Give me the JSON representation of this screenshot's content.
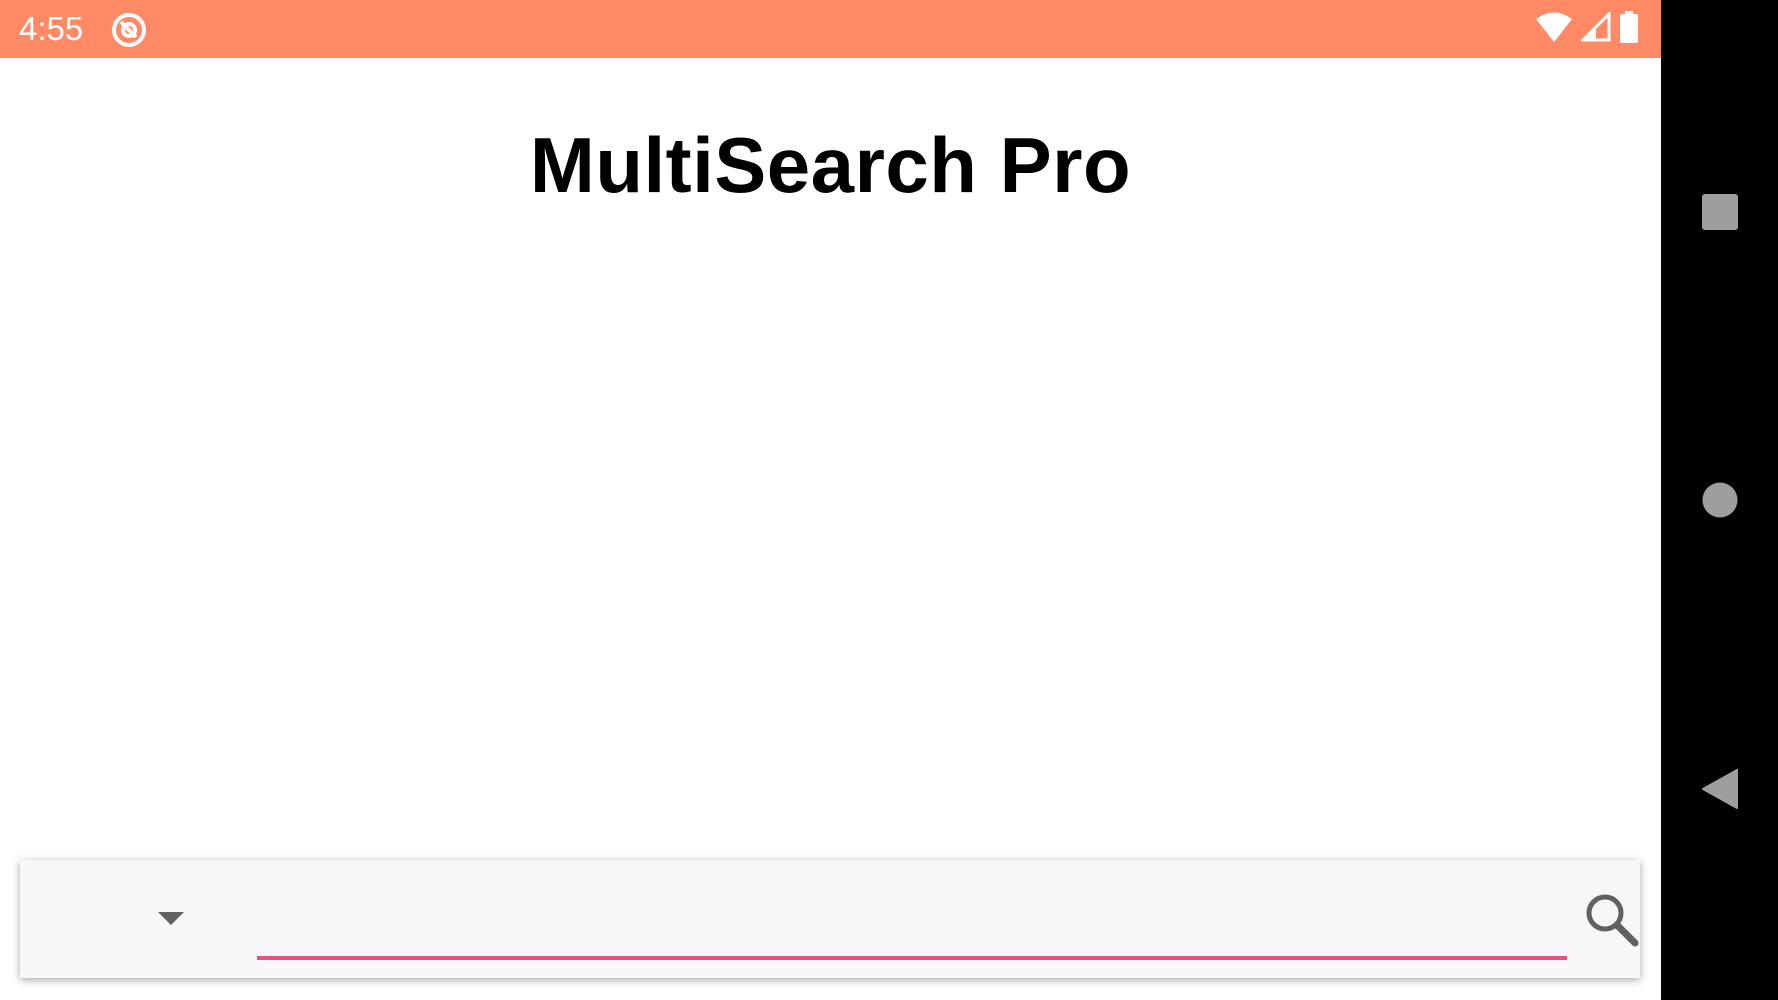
{
  "status_bar": {
    "time": "4:55",
    "background_color": "#ff8a65",
    "icons": {
      "notification": "at-sign-icon",
      "wifi": "wifi-icon",
      "signal": "cell-signal-icon",
      "battery": "battery-icon"
    }
  },
  "app": {
    "title": "MultiSearch Pro"
  },
  "search": {
    "engine_selected": "",
    "query_value": "",
    "placeholder": "",
    "underline_color": "#e5527a",
    "button_icon": "search-icon"
  },
  "navigation": {
    "recents": "square-icon",
    "home": "circle-icon",
    "back": "triangle-back-icon"
  }
}
